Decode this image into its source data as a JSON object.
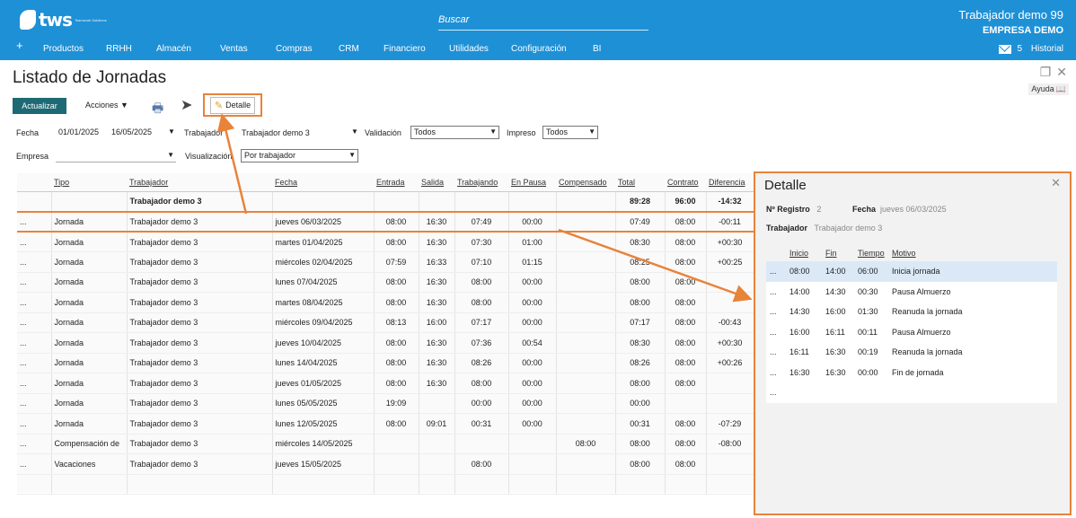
{
  "header": {
    "logo_text": "tws",
    "logo_sub": "Teamwork Solutions",
    "search_placeholder": "Buscar",
    "user": "Trabajador demo 99",
    "company": "EMPRESA DEMO",
    "mail_count": "5",
    "historial": "Historial"
  },
  "menu": [
    "+",
    "Productos",
    "RRHH",
    "Almacén",
    "Ventas",
    "Compras",
    "CRM",
    "Financiero",
    "Utilidades",
    "Configuración",
    "BI"
  ],
  "page": {
    "title": "Listado de Jornadas",
    "ayuda": "Ayuda"
  },
  "toolbar": {
    "actualizar": "Actualizar",
    "acciones": "Acciones",
    "detalle": "Detalle"
  },
  "filters": {
    "fecha_label": "Fecha",
    "fecha_desde": "01/01/2025",
    "fecha_hasta": "16/05/2025",
    "trabajador_label": "Trabajador",
    "trabajador_value": "Trabajador demo 3",
    "validacion_label": "Validación",
    "validacion_value": "Todos",
    "impreso_label": "Impreso",
    "impreso_value": "Todos",
    "empresa_label": "Empresa",
    "empresa_value": "",
    "visualizacion_label": "Visualización",
    "visualizacion_value": "Por trabajador"
  },
  "grid": {
    "columns": [
      "",
      "Tipo",
      "Trabajador",
      "Fecha",
      "Entrada",
      "Salida",
      "Trabajando",
      "En Pausa",
      "Compensado",
      "Total",
      "Contrato",
      "Diferencia"
    ],
    "summary": [
      "",
      "",
      "Trabajador demo 3",
      "",
      "",
      "",
      "",
      "",
      "",
      "89:28",
      "96:00",
      "-14:32"
    ],
    "rows": [
      [
        "...",
        "Jornada",
        "Trabajador demo 3",
        "jueves 06/03/2025",
        "08:00",
        "16:30",
        "07:49",
        "00:00",
        "",
        "07:49",
        "08:00",
        "-00:11"
      ],
      [
        "...",
        "Jornada",
        "Trabajador demo 3",
        "martes 01/04/2025",
        "08:00",
        "16:30",
        "07:30",
        "01:00",
        "",
        "08:30",
        "08:00",
        "+00:30"
      ],
      [
        "...",
        "Jornada",
        "Trabajador demo 3",
        "miércoles 02/04/2025",
        "07:59",
        "16:33",
        "07:10",
        "01:15",
        "",
        "08:25",
        "08:00",
        "+00:25"
      ],
      [
        "...",
        "Jornada",
        "Trabajador demo 3",
        "lunes 07/04/2025",
        "08:00",
        "16:30",
        "08:00",
        "00:00",
        "",
        "08:00",
        "08:00",
        ""
      ],
      [
        "...",
        "Jornada",
        "Trabajador demo 3",
        "martes 08/04/2025",
        "08:00",
        "16:30",
        "08:00",
        "00:00",
        "",
        "08:00",
        "08:00",
        ""
      ],
      [
        "...",
        "Jornada",
        "Trabajador demo 3",
        "miércoles 09/04/2025",
        "08:13",
        "16:00",
        "07:17",
        "00:00",
        "",
        "07:17",
        "08:00",
        "-00:43"
      ],
      [
        "...",
        "Jornada",
        "Trabajador demo 3",
        "jueves 10/04/2025",
        "08:00",
        "16:30",
        "07:36",
        "00:54",
        "",
        "08:30",
        "08:00",
        "+00:30"
      ],
      [
        "...",
        "Jornada",
        "Trabajador demo 3",
        "lunes 14/04/2025",
        "08:00",
        "16:30",
        "08:26",
        "00:00",
        "",
        "08:26",
        "08:00",
        "+00:26"
      ],
      [
        "...",
        "Jornada",
        "Trabajador demo 3",
        "jueves 01/05/2025",
        "08:00",
        "16:30",
        "08:00",
        "00:00",
        "",
        "08:00",
        "08:00",
        ""
      ],
      [
        "...",
        "Jornada",
        "Trabajador demo 3",
        "lunes 05/05/2025",
        "19:09",
        "",
        "00:00",
        "00:00",
        "",
        "00:00",
        "",
        ""
      ],
      [
        "...",
        "Jornada",
        "Trabajador demo 3",
        "lunes 12/05/2025",
        "08:00",
        "09:01",
        "00:31",
        "00:00",
        "",
        "00:31",
        "08:00",
        "-07:29"
      ],
      [
        "...",
        "Compensación de",
        "Trabajador demo 3",
        "miércoles 14/05/2025",
        "",
        "",
        "",
        "",
        "08:00",
        "08:00",
        "08:00",
        "-08:00"
      ],
      [
        "...",
        "Vacaciones",
        "Trabajador demo 3",
        "jueves 15/05/2025",
        "",
        "",
        "08:00",
        "",
        "",
        "08:00",
        "08:00",
        ""
      ]
    ]
  },
  "detail": {
    "title": "Detalle",
    "registro_label": "Nº Registro",
    "registro_value": "2",
    "fecha_label": "Fecha",
    "fecha_value": "jueves 06/03/2025",
    "trabajador_label": "Trabajador",
    "trabajador_value": "Trabajador demo 3",
    "columns": [
      "",
      "Inicio",
      "Fin",
      "Tiempo",
      "Motivo"
    ],
    "rows": [
      [
        "...",
        "08:00",
        "14:00",
        "06:00",
        "Inicia jornada"
      ],
      [
        "...",
        "14:00",
        "14:30",
        "00:30",
        "Pausa Almuerzo"
      ],
      [
        "...",
        "14:30",
        "16:00",
        "01:30",
        "Reanuda la jornada"
      ],
      [
        "...",
        "16:00",
        "16:11",
        "00:11",
        "Pausa Almuerzo"
      ],
      [
        "...",
        "16:11",
        "16:30",
        "00:19",
        "Reanuda la jornada"
      ],
      [
        "...",
        "16:30",
        "16:30",
        "00:00",
        "Fin de jornada"
      ],
      [
        "...",
        "",
        "",
        "",
        ""
      ]
    ]
  },
  "colors": {
    "brand": "#1e90d6",
    "highlight": "#e8833a",
    "primary_button": "#1e6a74"
  }
}
